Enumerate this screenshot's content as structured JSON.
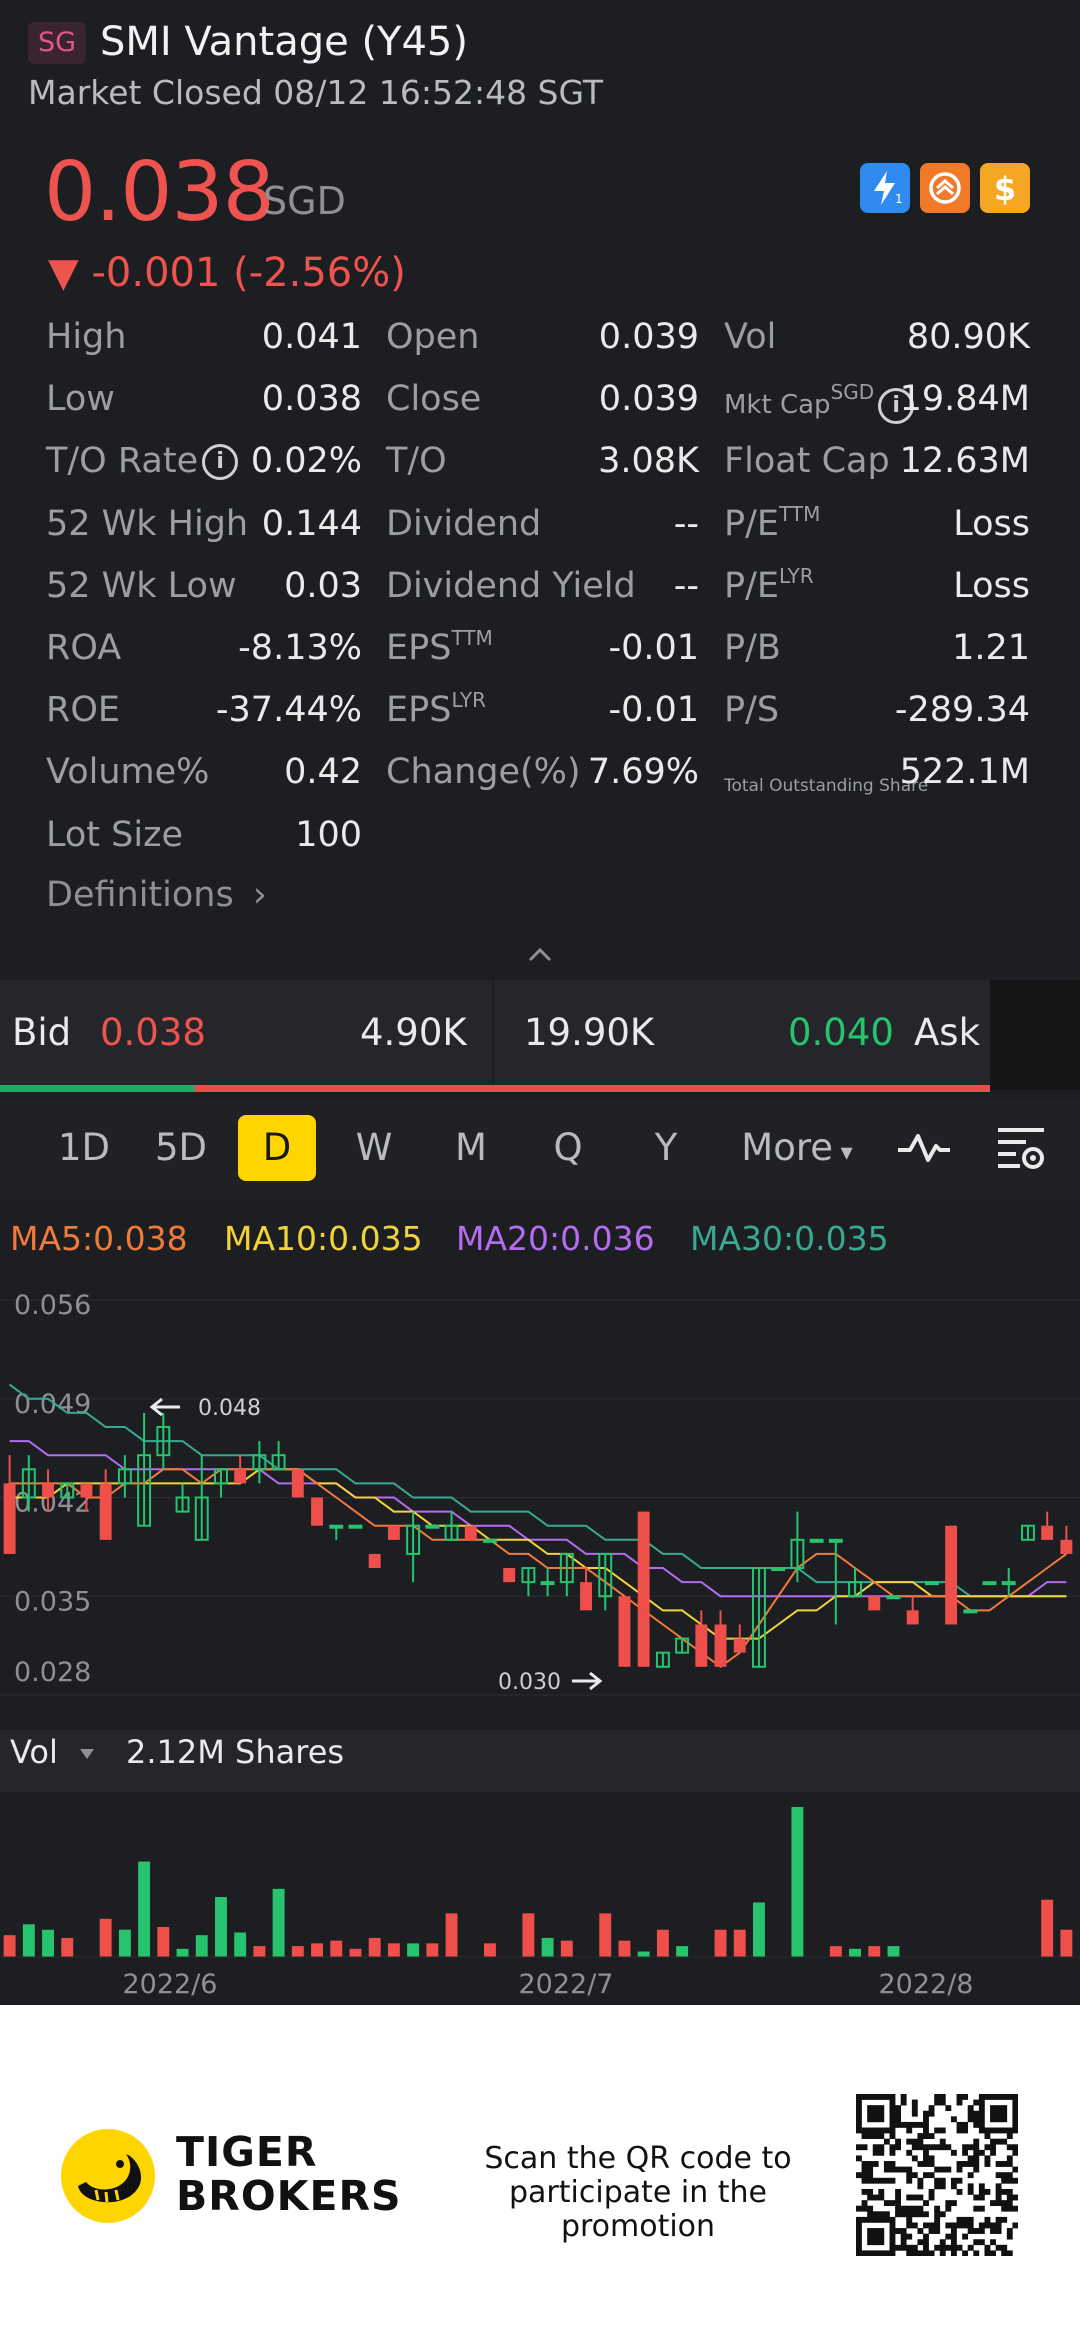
{
  "header": {
    "badge": "SG",
    "title": "SMI Vantage (Y45)",
    "status": "Market Closed 08/12 16:52:48 SGT"
  },
  "quote": {
    "price": "0.038",
    "currency": "SGD",
    "change": "▼ -0.001 (-2.56%)",
    "icons": [
      "lightning-icon",
      "swap-icon",
      "dollar-icon"
    ]
  },
  "stats": {
    "col1": [
      {
        "label": "High",
        "value": "0.041"
      },
      {
        "label": "Low",
        "value": "0.038"
      },
      {
        "label": "T/O Rate",
        "value": "0.02%"
      },
      {
        "label": "52 Wk High",
        "value": "0.144"
      },
      {
        "label": "52 Wk Low",
        "value": "0.03"
      },
      {
        "label": "ROA",
        "value": "-8.13%"
      },
      {
        "label": "ROE",
        "value": "-37.44%"
      },
      {
        "label": "Volume%",
        "value": "0.42"
      },
      {
        "label": "Lot Size",
        "value": "100"
      }
    ],
    "col2": [
      {
        "label": "Open",
        "value": "0.039"
      },
      {
        "label": "Close",
        "value": "0.039"
      },
      {
        "label": "T/O",
        "value": "3.08K"
      },
      {
        "label": "Dividend",
        "value": "--"
      },
      {
        "label": "Dividend Yield",
        "value": "--"
      },
      {
        "label": "EPS",
        "sup": "TTM",
        "value": "-0.01"
      },
      {
        "label": "EPS",
        "sup": "LYR",
        "value": "-0.01"
      },
      {
        "label": "Change(%)",
        "value": "7.69%"
      }
    ],
    "col3": [
      {
        "label": "Vol",
        "value": "80.90K"
      },
      {
        "label": "Mkt Cap",
        "sup": "SGD",
        "value": "19.84M"
      },
      {
        "label": "Float Cap",
        "value": "12.63M"
      },
      {
        "label": "P/E",
        "sup": "TTM",
        "value": "Loss"
      },
      {
        "label": "P/E",
        "sup": "LYR",
        "value": "Loss"
      },
      {
        "label": "P/B",
        "value": "1.21"
      },
      {
        "label": "P/S",
        "value": "-289.34"
      },
      {
        "label": "Total Outstanding Share",
        "value": "522.1M"
      }
    ],
    "definitions": "Definitions"
  },
  "bidask": {
    "bid_label": "Bid",
    "bid_price": "0.038",
    "bid_size": "4.90K",
    "ask_size": "19.90K",
    "ask_price": "0.040",
    "ask_label": "Ask",
    "bid_share": 0.197
  },
  "periods": {
    "items": [
      "1D",
      "5D",
      "D",
      "W",
      "M",
      "Q",
      "Y",
      "More"
    ],
    "active": "D"
  },
  "ma": {
    "ma5": "MA5:0.038",
    "ma10": "MA10:0.035",
    "ma20": "MA20:0.036",
    "ma30": "MA30:0.035",
    "colors": {
      "ma5": "#f07a3a",
      "ma10": "#f2d33a",
      "ma20": "#b46cf0",
      "ma30": "#3aa890"
    }
  },
  "colors": {
    "up": "#26c46e",
    "down": "#ef4f4a",
    "accent": "#ffd500"
  },
  "chart_data": {
    "type": "candlestick",
    "y_ticks": [
      "0.056",
      "0.049",
      "0.042",
      "0.035",
      "0.028"
    ],
    "ylim": [
      0.028,
      0.056
    ],
    "x_labels": [
      "2022/6",
      "2022/7",
      "2022/8"
    ],
    "high_marker": "0.048",
    "low_marker": "0.030",
    "volume_label": "Vol",
    "volume_value": "2.12M Shares",
    "candles": [
      {
        "o": 0.043,
        "c": 0.038,
        "h": 0.045,
        "l": 0.038
      },
      {
        "o": 0.042,
        "c": 0.044,
        "h": 0.045,
        "l": 0.041
      },
      {
        "o": 0.043,
        "c": 0.042,
        "h": 0.044,
        "l": 0.041
      },
      {
        "o": 0.042,
        "c": 0.043,
        "h": 0.043,
        "l": 0.042
      },
      {
        "o": 0.043,
        "c": 0.042,
        "h": 0.043,
        "l": 0.041
      },
      {
        "o": 0.043,
        "c": 0.039,
        "h": 0.044,
        "l": 0.039
      },
      {
        "o": 0.043,
        "c": 0.044,
        "h": 0.045,
        "l": 0.042
      },
      {
        "o": 0.04,
        "c": 0.045,
        "h": 0.048,
        "l": 0.04
      },
      {
        "o": 0.045,
        "c": 0.047,
        "h": 0.048,
        "l": 0.044
      },
      {
        "o": 0.041,
        "c": 0.042,
        "h": 0.043,
        "l": 0.041
      },
      {
        "o": 0.039,
        "c": 0.042,
        "h": 0.045,
        "l": 0.039
      },
      {
        "o": 0.043,
        "c": 0.044,
        "h": 0.044,
        "l": 0.042
      },
      {
        "o": 0.044,
        "c": 0.043,
        "h": 0.045,
        "l": 0.043
      },
      {
        "o": 0.044,
        "c": 0.045,
        "h": 0.046,
        "l": 0.043
      },
      {
        "o": 0.044,
        "c": 0.045,
        "h": 0.046,
        "l": 0.044
      },
      {
        "o": 0.044,
        "c": 0.042,
        "h": 0.044,
        "l": 0.042
      },
      {
        "o": 0.042,
        "c": 0.04,
        "h": 0.042,
        "l": 0.04
      },
      {
        "o": 0.04,
        "c": 0.04,
        "h": 0.04,
        "l": 0.039
      },
      {
        "o": 0.04,
        "c": 0.04,
        "h": 0.04,
        "l": 0.04
      },
      {
        "o": 0.038,
        "c": 0.037,
        "h": 0.038,
        "l": 0.037
      },
      {
        "o": 0.04,
        "c": 0.039,
        "h": 0.04,
        "l": 0.039
      },
      {
        "o": 0.038,
        "c": 0.04,
        "h": 0.041,
        "l": 0.036
      },
      {
        "o": 0.04,
        "c": 0.04,
        "h": 0.04,
        "l": 0.04
      },
      {
        "o": 0.039,
        "c": 0.04,
        "h": 0.041,
        "l": 0.039
      },
      {
        "o": 0.04,
        "c": 0.039,
        "h": 0.04,
        "l": 0.039
      },
      {
        "o": 0.039,
        "c": 0.039,
        "h": 0.039,
        "l": 0.039
      },
      {
        "o": 0.037,
        "c": 0.036,
        "h": 0.037,
        "l": 0.036
      },
      {
        "o": 0.036,
        "c": 0.037,
        "h": 0.037,
        "l": 0.035
      },
      {
        "o": 0.036,
        "c": 0.036,
        "h": 0.037,
        "l": 0.035
      },
      {
        "o": 0.036,
        "c": 0.038,
        "h": 0.038,
        "l": 0.035
      },
      {
        "o": 0.036,
        "c": 0.034,
        "h": 0.037,
        "l": 0.034
      },
      {
        "o": 0.035,
        "c": 0.038,
        "h": 0.038,
        "l": 0.034
      },
      {
        "o": 0.035,
        "c": 0.03,
        "h": 0.035,
        "l": 0.03
      },
      {
        "o": 0.041,
        "c": 0.03,
        "h": 0.041,
        "l": 0.03
      },
      {
        "o": 0.03,
        "c": 0.031,
        "h": 0.031,
        "l": 0.03
      },
      {
        "o": 0.031,
        "c": 0.032,
        "h": 0.032,
        "l": 0.031
      },
      {
        "o": 0.033,
        "c": 0.03,
        "h": 0.034,
        "l": 0.03
      },
      {
        "o": 0.033,
        "c": 0.03,
        "h": 0.034,
        "l": 0.03
      },
      {
        "o": 0.032,
        "c": 0.031,
        "h": 0.033,
        "l": 0.031
      },
      {
        "o": 0.03,
        "c": 0.037,
        "h": 0.037,
        "l": 0.03
      },
      {
        "o": 0.037,
        "c": 0.037,
        "h": 0.037,
        "l": 0.037
      },
      {
        "o": 0.037,
        "c": 0.039,
        "h": 0.041,
        "l": 0.036
      },
      {
        "o": 0.039,
        "c": 0.039,
        "h": 0.039,
        "l": 0.039
      },
      {
        "o": 0.039,
        "c": 0.039,
        "h": 0.039,
        "l": 0.033
      },
      {
        "o": 0.035,
        "c": 0.036,
        "h": 0.037,
        "l": 0.035
      },
      {
        "o": 0.035,
        "c": 0.034,
        "h": 0.035,
        "l": 0.034
      },
      {
        "o": 0.035,
        "c": 0.035,
        "h": 0.035,
        "l": 0.035
      },
      {
        "o": 0.034,
        "c": 0.033,
        "h": 0.035,
        "l": 0.033
      },
      {
        "o": 0.036,
        "c": 0.036,
        "h": 0.036,
        "l": 0.036
      },
      {
        "o": 0.04,
        "c": 0.033,
        "h": 0.04,
        "l": 0.033
      },
      {
        "o": 0.034,
        "c": 0.034,
        "h": 0.034,
        "l": 0.034
      },
      {
        "o": 0.036,
        "c": 0.036,
        "h": 0.036,
        "l": 0.036
      },
      {
        "o": 0.036,
        "c": 0.036,
        "h": 0.037,
        "l": 0.035
      },
      {
        "o": 0.039,
        "c": 0.04,
        "h": 0.04,
        "l": 0.039
      },
      {
        "o": 0.04,
        "c": 0.039,
        "h": 0.041,
        "l": 0.039
      },
      {
        "o": 0.039,
        "c": 0.038,
        "h": 0.04,
        "l": 0.038
      }
    ],
    "ma_series": {
      "ma5": [
        0.043,
        0.043,
        0.043,
        0.043,
        0.042,
        0.042,
        0.043,
        0.043,
        0.044,
        0.044,
        0.043,
        0.044,
        0.044,
        0.044,
        0.044,
        0.044,
        0.043,
        0.042,
        0.041,
        0.04,
        0.04,
        0.04,
        0.039,
        0.039,
        0.039,
        0.039,
        0.038,
        0.038,
        0.037,
        0.037,
        0.037,
        0.036,
        0.035,
        0.034,
        0.033,
        0.032,
        0.031,
        0.03,
        0.031,
        0.033,
        0.035,
        0.037,
        0.038,
        0.038,
        0.037,
        0.036,
        0.035,
        0.035,
        0.035,
        0.035,
        0.034,
        0.034,
        0.035,
        0.036,
        0.037,
        0.038
      ],
      "ma10": [
        0.042,
        0.042,
        0.042,
        0.043,
        0.043,
        0.043,
        0.043,
        0.043,
        0.043,
        0.043,
        0.043,
        0.043,
        0.043,
        0.044,
        0.044,
        0.044,
        0.043,
        0.043,
        0.042,
        0.042,
        0.041,
        0.041,
        0.04,
        0.04,
        0.04,
        0.039,
        0.039,
        0.039,
        0.038,
        0.038,
        0.037,
        0.037,
        0.036,
        0.035,
        0.034,
        0.034,
        0.033,
        0.032,
        0.032,
        0.032,
        0.033,
        0.034,
        0.034,
        0.035,
        0.035,
        0.036,
        0.036,
        0.036,
        0.035,
        0.035,
        0.035,
        0.035,
        0.035,
        0.035,
        0.035,
        0.035
      ],
      "ma20": [
        0.046,
        0.046,
        0.045,
        0.045,
        0.045,
        0.045,
        0.044,
        0.044,
        0.044,
        0.044,
        0.044,
        0.044,
        0.044,
        0.044,
        0.043,
        0.043,
        0.043,
        0.043,
        0.042,
        0.042,
        0.042,
        0.041,
        0.041,
        0.041,
        0.04,
        0.04,
        0.04,
        0.039,
        0.039,
        0.039,
        0.038,
        0.038,
        0.038,
        0.037,
        0.037,
        0.036,
        0.036,
        0.035,
        0.035,
        0.035,
        0.035,
        0.035,
        0.035,
        0.035,
        0.035,
        0.035,
        0.035,
        0.035,
        0.035,
        0.035,
        0.035,
        0.035,
        0.035,
        0.035,
        0.036,
        0.036
      ],
      "ma30": [
        0.05,
        0.049,
        0.049,
        0.048,
        0.048,
        0.047,
        0.047,
        0.046,
        0.046,
        0.046,
        0.045,
        0.045,
        0.045,
        0.045,
        0.044,
        0.044,
        0.044,
        0.044,
        0.043,
        0.043,
        0.043,
        0.042,
        0.042,
        0.042,
        0.041,
        0.041,
        0.041,
        0.041,
        0.04,
        0.04,
        0.04,
        0.039,
        0.039,
        0.039,
        0.038,
        0.038,
        0.037,
        0.037,
        0.037,
        0.037,
        0.037,
        0.037,
        0.036,
        0.036,
        0.036,
        0.036,
        0.036,
        0.036,
        0.036,
        0.036,
        0.035,
        0.035,
        0.035,
        0.035,
        0.035,
        0.035
      ]
    },
    "volumes": [
      {
        "v": 0.08,
        "up": false
      },
      {
        "v": 0.12,
        "up": true
      },
      {
        "v": 0.1,
        "up": true
      },
      {
        "v": 0.07,
        "up": false
      },
      {
        "v": 0.0,
        "up": true
      },
      {
        "v": 0.14,
        "up": false
      },
      {
        "v": 0.1,
        "up": true
      },
      {
        "v": 0.35,
        "up": true
      },
      {
        "v": 0.11,
        "up": false
      },
      {
        "v": 0.03,
        "up": true
      },
      {
        "v": 0.08,
        "up": true
      },
      {
        "v": 0.22,
        "up": true
      },
      {
        "v": 0.09,
        "up": true
      },
      {
        "v": 0.04,
        "up": false
      },
      {
        "v": 0.25,
        "up": true
      },
      {
        "v": 0.04,
        "up": false
      },
      {
        "v": 0.05,
        "up": false
      },
      {
        "v": 0.06,
        "up": false
      },
      {
        "v": 0.03,
        "up": false
      },
      {
        "v": 0.07,
        "up": false
      },
      {
        "v": 0.05,
        "up": false
      },
      {
        "v": 0.05,
        "up": true
      },
      {
        "v": 0.05,
        "up": false
      },
      {
        "v": 0.16,
        "up": false
      },
      {
        "v": 0.0,
        "up": true
      },
      {
        "v": 0.05,
        "up": false
      },
      {
        "v": 0.0,
        "up": true
      },
      {
        "v": 0.16,
        "up": false
      },
      {
        "v": 0.07,
        "up": true
      },
      {
        "v": 0.06,
        "up": false
      },
      {
        "v": 0.0,
        "up": true
      },
      {
        "v": 0.16,
        "up": false
      },
      {
        "v": 0.06,
        "up": false
      },
      {
        "v": 0.02,
        "up": true
      },
      {
        "v": 0.1,
        "up": false
      },
      {
        "v": 0.04,
        "up": true
      },
      {
        "v": 0.0,
        "up": true
      },
      {
        "v": 0.1,
        "up": false
      },
      {
        "v": 0.1,
        "up": false
      },
      {
        "v": 0.2,
        "up": true
      },
      {
        "v": 0.0,
        "up": true
      },
      {
        "v": 0.55,
        "up": true
      },
      {
        "v": 0.0,
        "up": true
      },
      {
        "v": 0.04,
        "up": false
      },
      {
        "v": 0.03,
        "up": true
      },
      {
        "v": 0.04,
        "up": false
      },
      {
        "v": 0.04,
        "up": true
      },
      {
        "v": 0.0,
        "up": true
      },
      {
        "v": 0.0,
        "up": true
      },
      {
        "v": 0.0,
        "up": true
      },
      {
        "v": 0.0,
        "up": true
      },
      {
        "v": 0.0,
        "up": true
      },
      {
        "v": 0.0,
        "up": true
      },
      {
        "v": 0.0,
        "up": true
      },
      {
        "v": 0.21,
        "up": false
      },
      {
        "v": 0.1,
        "up": false
      }
    ]
  },
  "footer": {
    "brand_line1": "TIGER",
    "brand_line2": "BROKERS",
    "promo_line1": "Scan the QR code to",
    "promo_line2": "participate in the promotion"
  }
}
